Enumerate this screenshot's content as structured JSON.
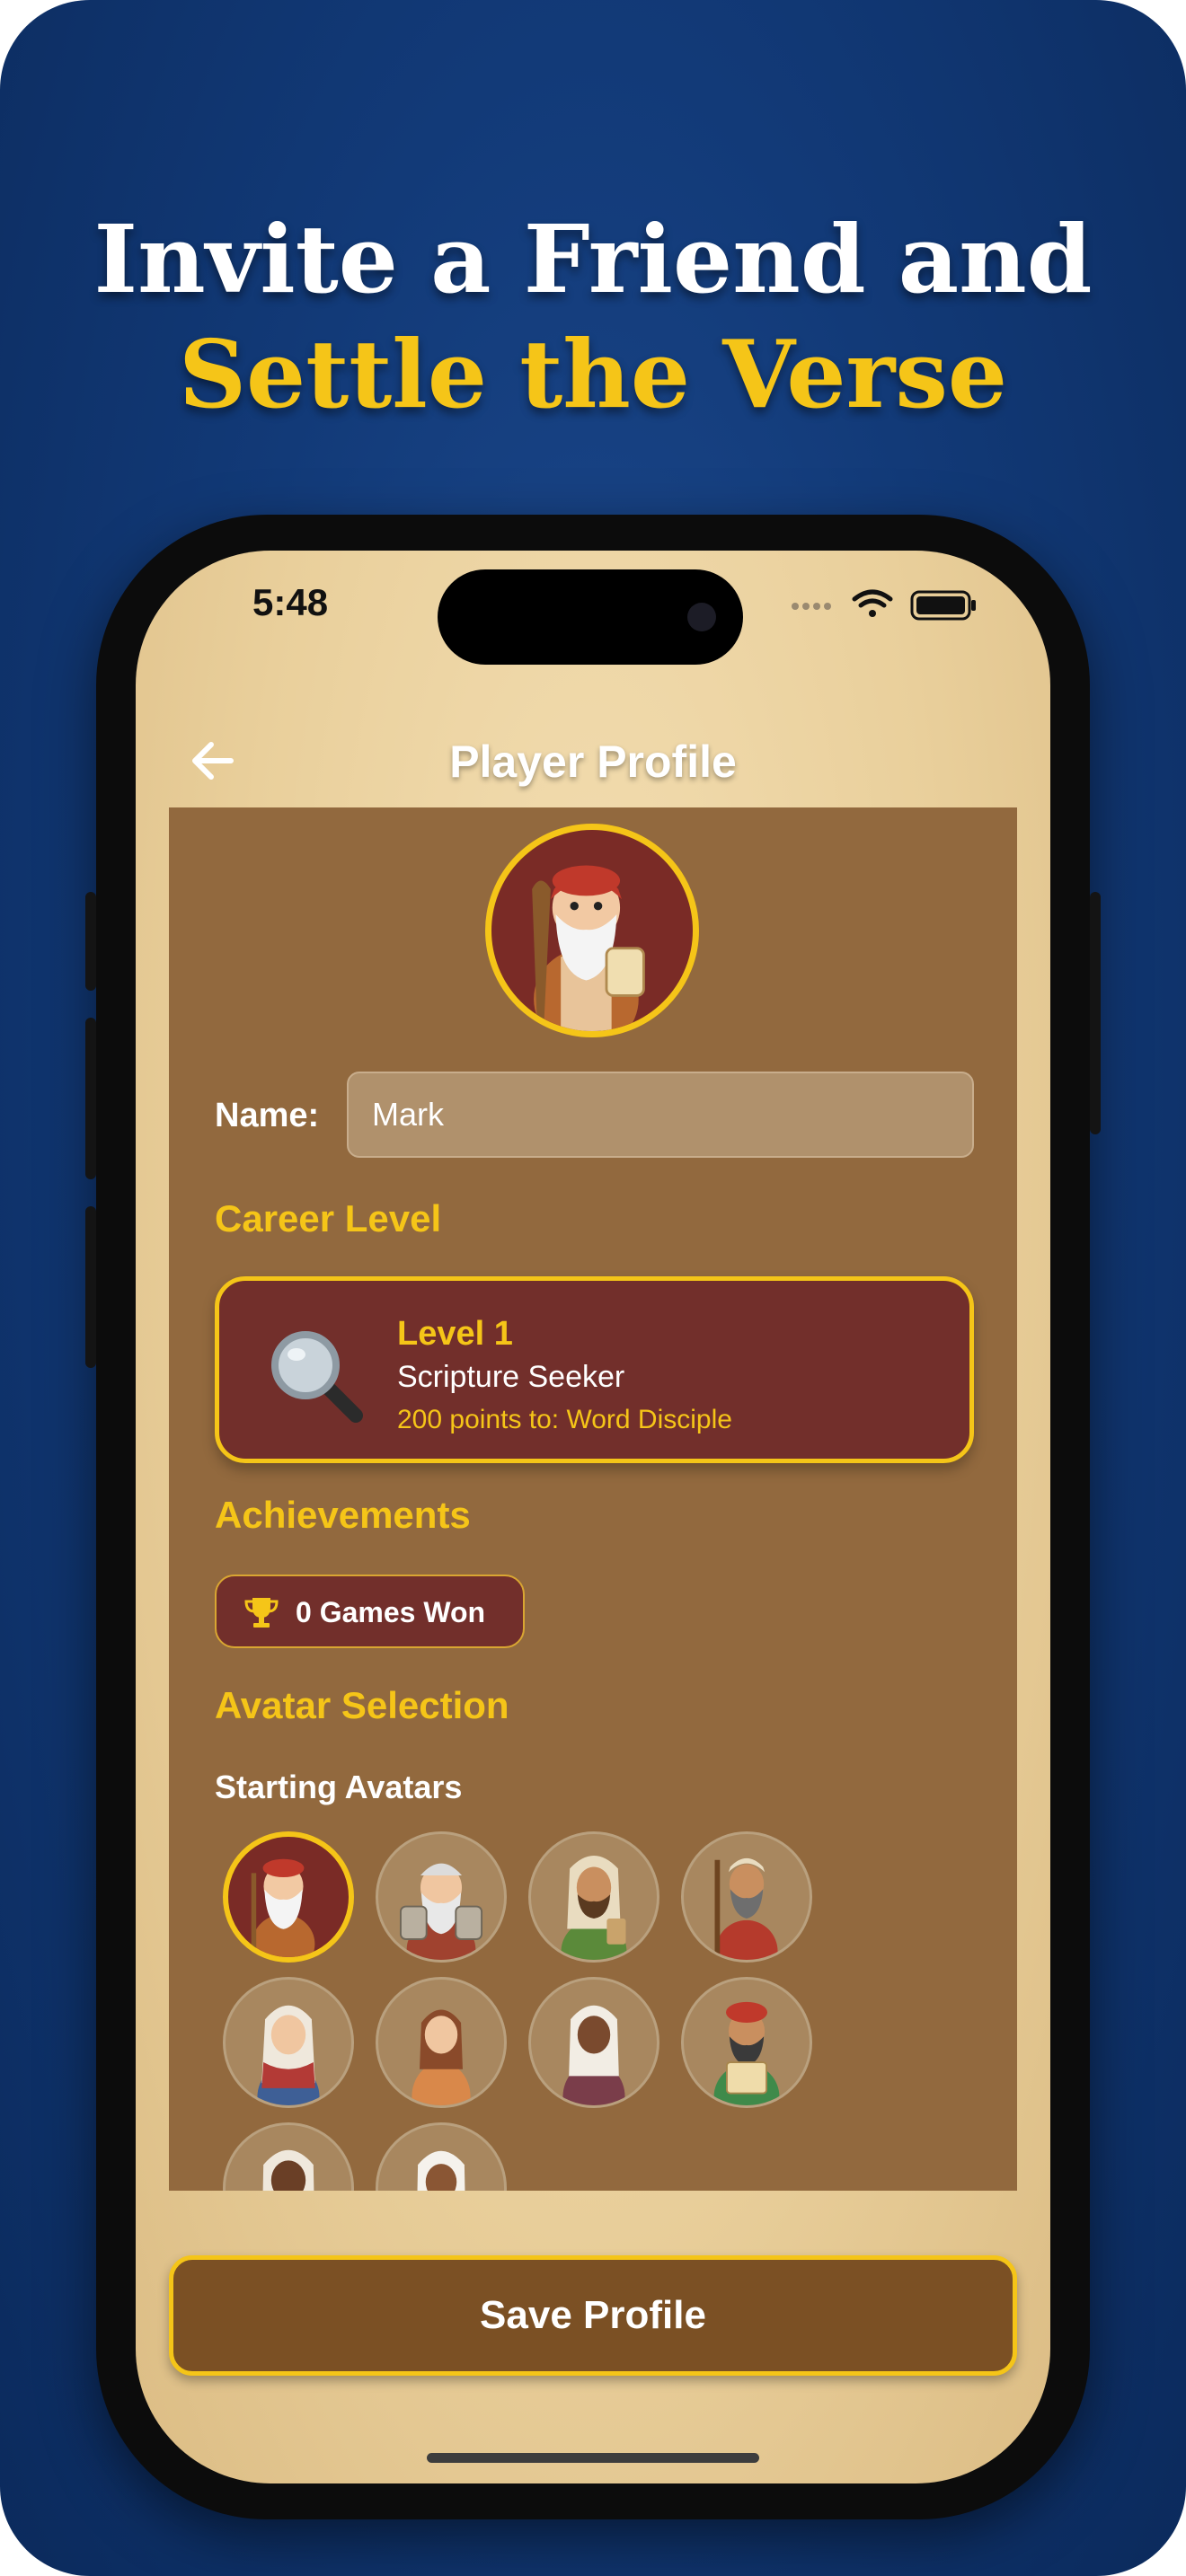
{
  "headline": {
    "line1": "Invite a Friend and",
    "line2": "Settle the Verse"
  },
  "colors": {
    "background_blue": "#123a78",
    "accent_gold": "#f5c518",
    "panel_brown": "#92693e",
    "card_maroon": "#722f2b",
    "parchment": "#e9cf9b"
  },
  "status_bar": {
    "time": "5:48",
    "icons": [
      "signal-dots-icon",
      "wifi-icon",
      "battery-icon"
    ]
  },
  "nav": {
    "back_icon": "arrow-left-icon",
    "title": "Player Profile"
  },
  "profile": {
    "name_label": "Name:",
    "name_value": "Mark"
  },
  "career": {
    "section_title": "Career Level",
    "icon": "magnifying-glass-icon",
    "level": "Level 1",
    "rank": "Scripture Seeker",
    "next": "200 points to: Word Disciple"
  },
  "achievements": {
    "section_title": "Achievements",
    "icon": "trophy-icon",
    "games_won": "0 Games Won"
  },
  "avatars": {
    "section_title": "Avatar Selection",
    "group_title": "Starting Avatars",
    "items": [
      {
        "name": "elder-red-turban",
        "selected": true
      },
      {
        "name": "moses-tablets",
        "selected": false
      },
      {
        "name": "young-man-green",
        "selected": false
      },
      {
        "name": "prophet-staff",
        "selected": false
      },
      {
        "name": "woman-blue-veil",
        "selected": false
      },
      {
        "name": "girl-orange-dress",
        "selected": false
      },
      {
        "name": "woman-white-veil",
        "selected": false
      },
      {
        "name": "scribe-scroll",
        "selected": false
      },
      {
        "name": "man-white-headcloth",
        "selected": false
      },
      {
        "name": "woman-white-headcloth",
        "selected": false
      }
    ]
  },
  "actions": {
    "save_label": "Save Profile"
  }
}
